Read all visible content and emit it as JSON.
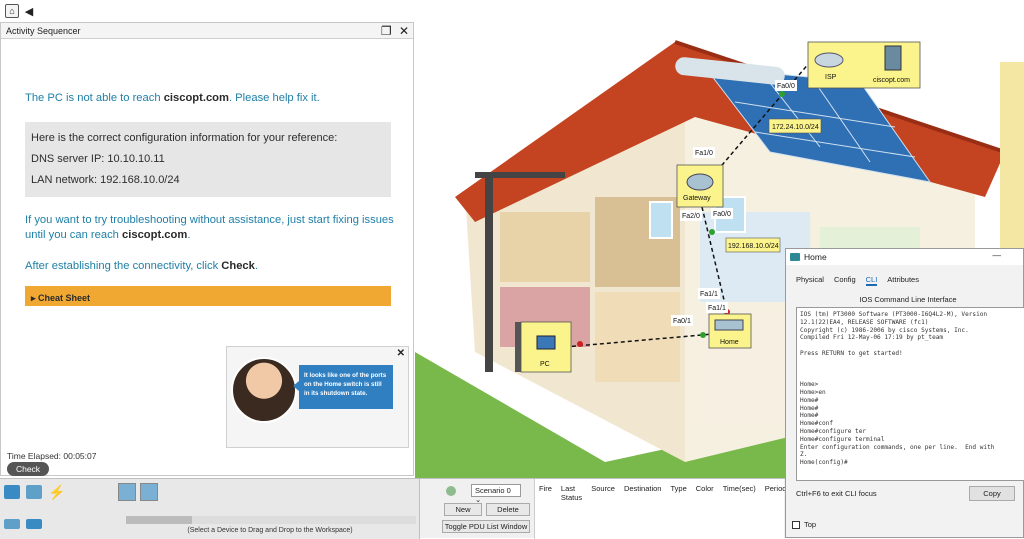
{
  "toolbar": {
    "app_icon": "app-icon",
    "back_icon": "back-icon"
  },
  "activity": {
    "title": "Activity Sequencer",
    "intro_prefix": "The PC is not able to reach ",
    "intro_host": "ciscopt.com",
    "intro_suffix": ". Please help fix it.",
    "ref_heading": "Here is the correct configuration information for your reference:",
    "dns": "DNS server IP: 10.10.10.11",
    "lan": "LAN network: 192.168.10.0/24",
    "trouble_prefix": "If you want to try troubleshooting without assistance, just start fixing issues until you can reach ",
    "trouble_host": "ciscopt.com",
    "trouble_suffix": ".",
    "after_prefix": "After establishing the connectivity, click ",
    "after_check": "Check",
    "after_suffix": ".",
    "cheat_sheet": "Cheat Sheet",
    "tip_text": "It looks like one of the ports on the Home switch is still in its shutdown state.",
    "timer": "Time Elapsed: 00:05:07",
    "check_button": "Check"
  },
  "network": {
    "isp": "ISP",
    "server": "ciscopt.com",
    "gateway": "Gateway",
    "home": "Home",
    "pc": "PC",
    "link_isp_net": "172.24.10.0/24",
    "link_lan_net": "192.168.10.0/24",
    "port_isp": "Fa0/0",
    "port_gw_up": "Fa1/0",
    "port_gw_a": "Fa2/0",
    "port_gw_b": "Fa0/0",
    "port_home_up": "Fa1/1",
    "port_home_b": "Fa1/1",
    "port_pc": "Fa0/1"
  },
  "bottom": {
    "device_hint": "(Select a Device to Drag and Drop to the Workspace)",
    "scenario": "Scenario 0",
    "new": "New",
    "delete": "Delete",
    "toggle_pdu": "Toggle PDU List Window",
    "pdu_cols": [
      "Fire",
      "Last Status",
      "Source",
      "Destination",
      "Type",
      "Color",
      "Time(sec)",
      "Periodi"
    ]
  },
  "cli": {
    "window_title": "Home",
    "tabs": [
      "Physical",
      "Config",
      "CLI",
      "Attributes"
    ],
    "active_tab": "CLI",
    "header": "IOS Command Line Interface",
    "terminal": "IOS (tm) PT3000 Software (PT3000-I6Q4L2-M), Version\n12.1(22)EA4, RELEASE SOFTWARE (fc1)\nCopyright (c) 1986-2006 by cisco Systems, Inc.\nCompiled Fri 12-May-06 17:19 by pt_team\n\nPress RETURN to get started!\n\n\n\nHome>\nHome>en\nHome#\nHome#\nHome#\nHome#conf\nHome#configure ter\nHome#configure terminal\nEnter configuration commands, one per line.  End with\nZ.\nHome(config)#",
    "footer": "Ctrl+F6 to exit CLI focus",
    "copy": "Copy",
    "top_label": "Top"
  }
}
